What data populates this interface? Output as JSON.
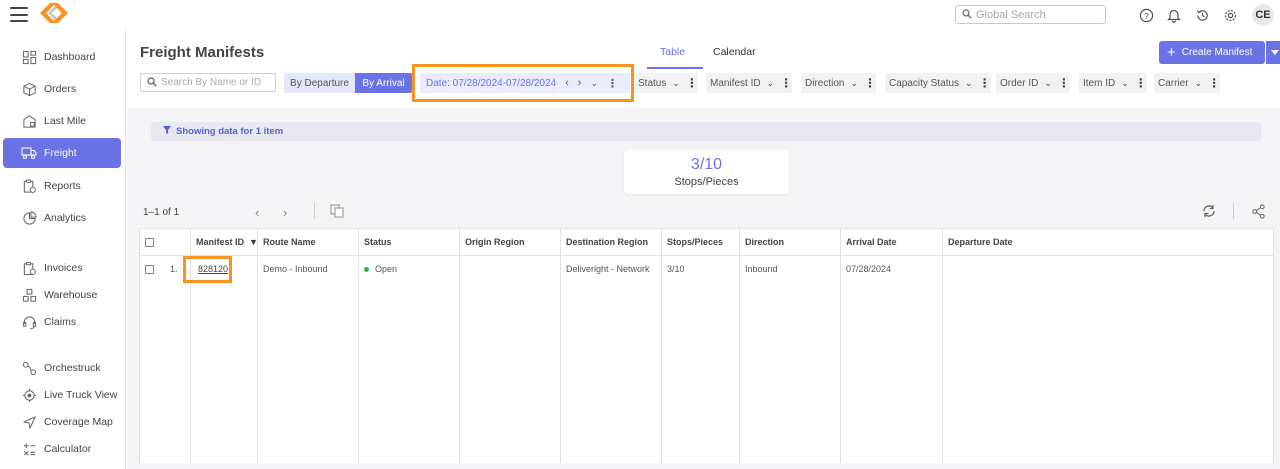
{
  "topbar": {
    "search_placeholder": "Global Search",
    "avatar": "CE",
    "icons": [
      "menu-icon",
      "app-logo",
      "search-icon",
      "help-icon",
      "bell-icon",
      "history-icon",
      "gear-icon"
    ]
  },
  "sidebar": {
    "items": [
      {
        "label": "Dashboard",
        "icon": "dashboard-icon"
      },
      {
        "label": "Orders",
        "icon": "box-icon"
      },
      {
        "label": "Last Mile",
        "icon": "last-mile-icon"
      },
      {
        "label": "Freight",
        "icon": "truck-icon",
        "active": true
      },
      {
        "label": "Reports",
        "icon": "reports-icon"
      },
      {
        "label": "Analytics",
        "icon": "analytics-icon"
      },
      {
        "label": "Invoices",
        "icon": "invoice-icon"
      },
      {
        "label": "Warehouse",
        "icon": "warehouse-icon"
      },
      {
        "label": "Claims",
        "icon": "headset-icon"
      },
      {
        "label": "Orchestruck",
        "icon": "orchestruck-icon"
      },
      {
        "label": "Live Truck View",
        "icon": "location-icon"
      },
      {
        "label": "Coverage Map",
        "icon": "navigation-icon"
      },
      {
        "label": "Calculator",
        "icon": "calculator-icon"
      }
    ]
  },
  "header": {
    "title": "Freight Manifests",
    "tabs": [
      "Table",
      "Calendar"
    ],
    "active_tab": "Table",
    "create_label": "Create Manifest"
  },
  "filters": {
    "search_placeholder": "Search By Name or ID",
    "by_departure": "By Departure",
    "by_arrival": "By Arrival",
    "date_label": "Date: 07/28/2024-07/28/2024",
    "chips": [
      "Status",
      "Manifest ID",
      "Direction",
      "Capacity Status",
      "Order ID",
      "Item ID",
      "Carrier"
    ]
  },
  "info": {
    "showing": "Showing data for 1 item"
  },
  "stat": {
    "value": "3/10",
    "label": "Stops/Pieces"
  },
  "pager": {
    "range": "1–1 of 1"
  },
  "table": {
    "columns": [
      "Manifest ID",
      "Route Name",
      "Status",
      "Origin Region",
      "Destination Region",
      "Stops/Pieces",
      "Direction",
      "Arrival Date",
      "Departure Date"
    ],
    "rows": [
      {
        "index": "1.",
        "manifest_id": "828120",
        "route_name": "Demo - Inbound",
        "status": "Open",
        "origin_region": "",
        "destination_region": "Deliveright - Network",
        "stops_pieces": "3/10",
        "direction": "Inbound",
        "arrival_date": "07/28/2024",
        "departure_date": ""
      }
    ]
  },
  "colors": {
    "accent": "#6b72e5",
    "highlight": "#f7931e",
    "status_open": "#2eae4f"
  }
}
